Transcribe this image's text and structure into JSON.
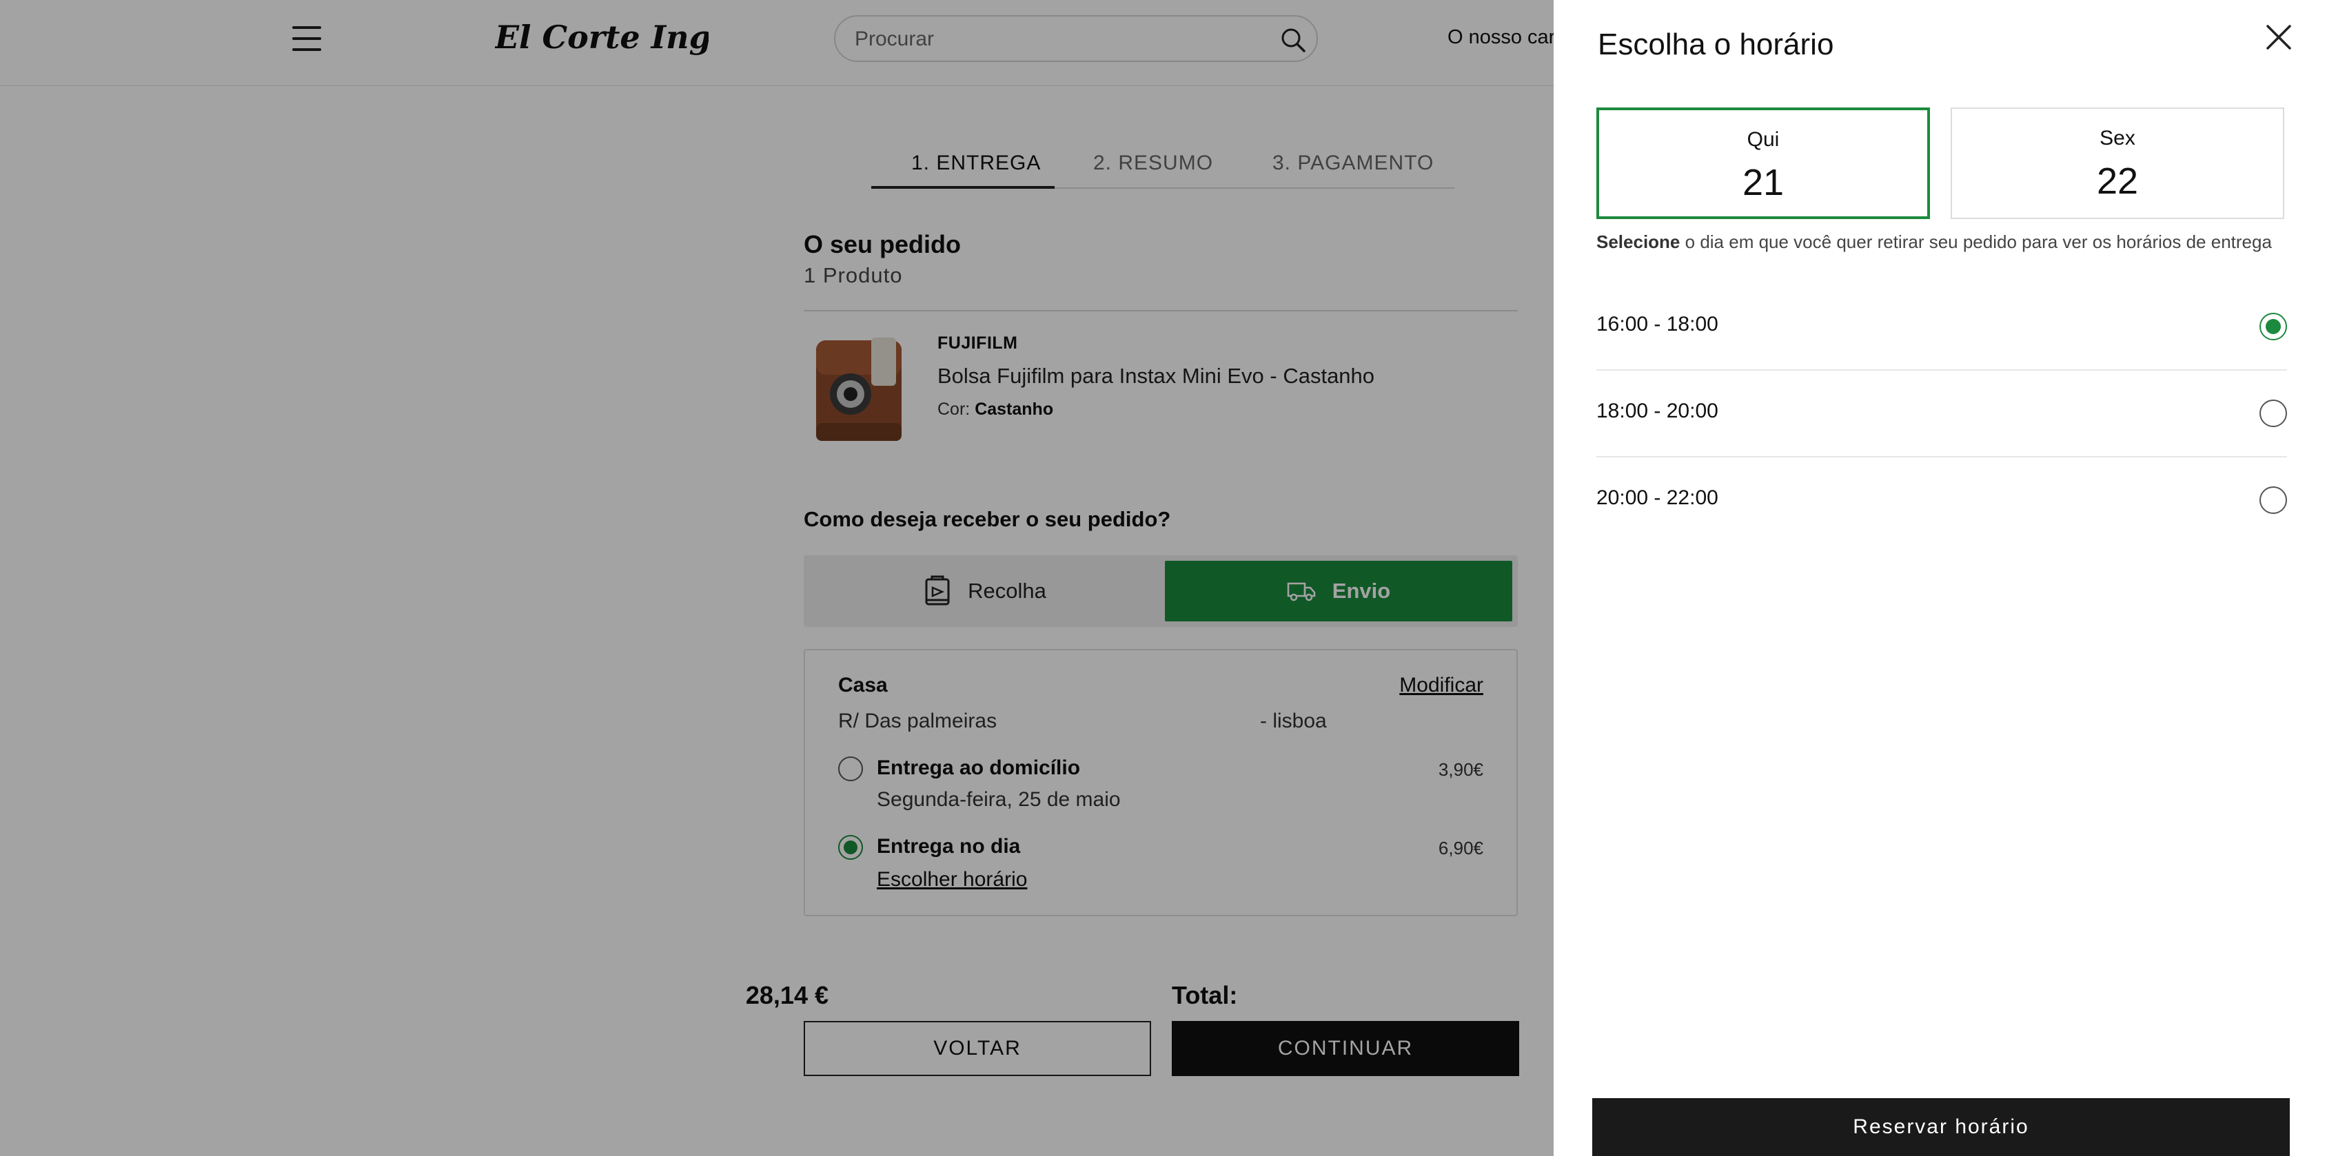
{
  "header": {
    "logo_text": "El Corte Inglés",
    "search_placeholder": "Procurar",
    "cart_link": "O nosso cart"
  },
  "steps": [
    {
      "label": "1. ENTREGA",
      "active": true
    },
    {
      "label": "2. RESUMO",
      "active": false
    },
    {
      "label": "3. PAGAMENTO",
      "active": false
    }
  ],
  "order": {
    "title": "O seu pedido",
    "count": "1 Produto",
    "product": {
      "brand": "FUJIFILM",
      "name": "Bolsa Fujifilm para Instax Mini Evo - Castanho",
      "color_label": "Cor:",
      "color_value": "Castanho"
    }
  },
  "delivery": {
    "question": "Como deseja receber o seu pedido?",
    "pickup_label": "Recolha",
    "ship_label": "Envio",
    "selected": "Envio",
    "address": {
      "name": "Casa",
      "modify": "Modificar",
      "street": "R/ Das palmeiras",
      "city": "- lisboa"
    },
    "options": [
      {
        "title": "Entrega ao domicílio",
        "subtitle": "Segunda-feira, 25 de maio",
        "price": "3,90€",
        "selected": false
      },
      {
        "title": "Entrega no dia",
        "link": "Escolher horário",
        "price": "6,90€",
        "selected": true
      }
    ]
  },
  "totals": {
    "label": "Total:",
    "value": "28,14 €"
  },
  "buttons": {
    "back": "VOLTAR",
    "continue": "CONTINUAR"
  },
  "panel": {
    "title": "Escolha o horário",
    "days": [
      {
        "name": "Qui",
        "number": "21",
        "selected": true
      },
      {
        "name": "Sex",
        "number": "22",
        "selected": false
      }
    ],
    "hint_bold": "Selecione",
    "hint_rest": " o dia em que você quer retirar seu pedido para ver os horários de entrega",
    "slots": [
      {
        "time": "16:00 - 18:00",
        "selected": true
      },
      {
        "time": "18:00 - 20:00",
        "selected": false
      },
      {
        "time": "20:00 - 22:00",
        "selected": false
      }
    ],
    "reserve_label": "Reservar horário"
  },
  "colors": {
    "accent_green": "#1c8a3e",
    "dark": "#111111",
    "overlay": "rgba(0,0,0,0.36)"
  }
}
